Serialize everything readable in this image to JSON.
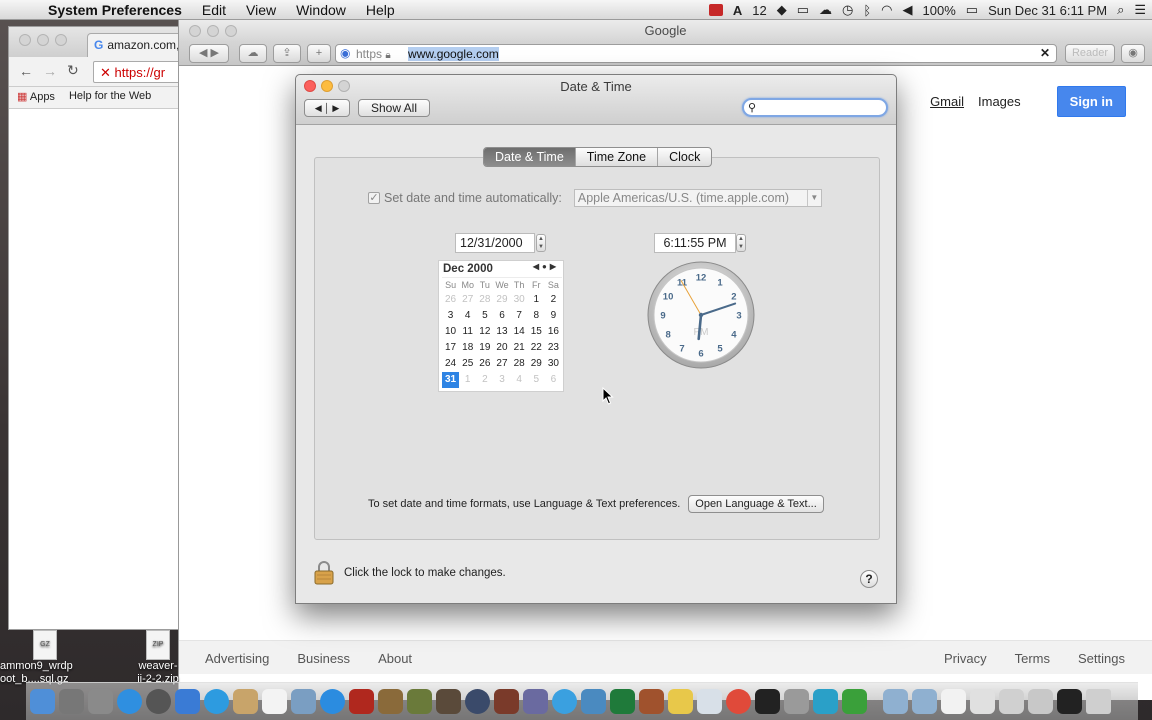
{
  "menubar": {
    "app_name": "System Preferences",
    "menus": [
      "Edit",
      "View",
      "Window",
      "Help"
    ],
    "status_badge": "12",
    "battery": "100%",
    "clock": "Sun Dec 31  6:11 PM"
  },
  "chrome_window": {
    "tab_label": "amazon.com, ",
    "url_text": "https://gr",
    "bookmarks": [
      "Apps",
      "Help for the Web"
    ]
  },
  "safari": {
    "title": "Google",
    "url_protocol": "https",
    "url_host": "www.google.com",
    "reader_label": "Reader",
    "google_links": [
      "Gmail",
      "Images"
    ],
    "sign_in": "Sign in",
    "footer_left": [
      "Advertising",
      "Business",
      "About"
    ],
    "footer_right": [
      "Privacy",
      "Terms",
      "Settings"
    ]
  },
  "syspref": {
    "title": "Date & Time",
    "show_all": "Show All",
    "search_value": "",
    "tabs": [
      {
        "label": "Date & Time",
        "selected": true
      },
      {
        "label": "Time Zone",
        "selected": false
      },
      {
        "label": "Clock",
        "selected": false
      }
    ],
    "auto_label": "Set date and time automatically:",
    "auto_checked": true,
    "time_server": "Apple Americas/U.S. (time.apple.com)",
    "date_value": "12/31/2000",
    "time_value": "6:11:55 PM",
    "calendar": {
      "month_label": "Dec 2000",
      "weekdays": [
        "Su",
        "Mo",
        "Tu",
        "We",
        "Th",
        "Fr",
        "Sa"
      ],
      "weeks": [
        [
          "26",
          "27",
          "28",
          "29",
          "30",
          "1",
          "2"
        ],
        [
          "3",
          "4",
          "5",
          "6",
          "7",
          "8",
          "9"
        ],
        [
          "10",
          "11",
          "12",
          "13",
          "14",
          "15",
          "16"
        ],
        [
          "17",
          "18",
          "19",
          "20",
          "21",
          "22",
          "23"
        ],
        [
          "24",
          "25",
          "26",
          "27",
          "28",
          "29",
          "30"
        ],
        [
          "31",
          "1",
          "2",
          "3",
          "4",
          "5",
          "6"
        ]
      ],
      "selected_day": "31"
    },
    "clock_face": {
      "numbers": [
        "12",
        "1",
        "2",
        "3",
        "4",
        "5",
        "6",
        "7",
        "8",
        "9",
        "10",
        "11"
      ],
      "ampm": "PM",
      "hour": 6,
      "minute": 11,
      "second": 55
    },
    "format_text": "To set date and time formats, use Language & Text preferences.",
    "format_button": "Open Language & Text...",
    "lock_text": "Click the lock to make changes.",
    "help_label": "?"
  },
  "desktop_files": [
    {
      "name": "ammon9_wrdp\noot_b....sql.gz",
      "badge": "GZ"
    },
    {
      "name": "weaver-\nii-2-2.zip",
      "badge": "ZIP"
    }
  ],
  "colors": {
    "accent_blue": "#2e84e4",
    "signin_blue": "#4787ed",
    "close_red": "#fc605c",
    "minimize_yellow": "#fdbc40",
    "zoom_green": "#34c84a"
  }
}
